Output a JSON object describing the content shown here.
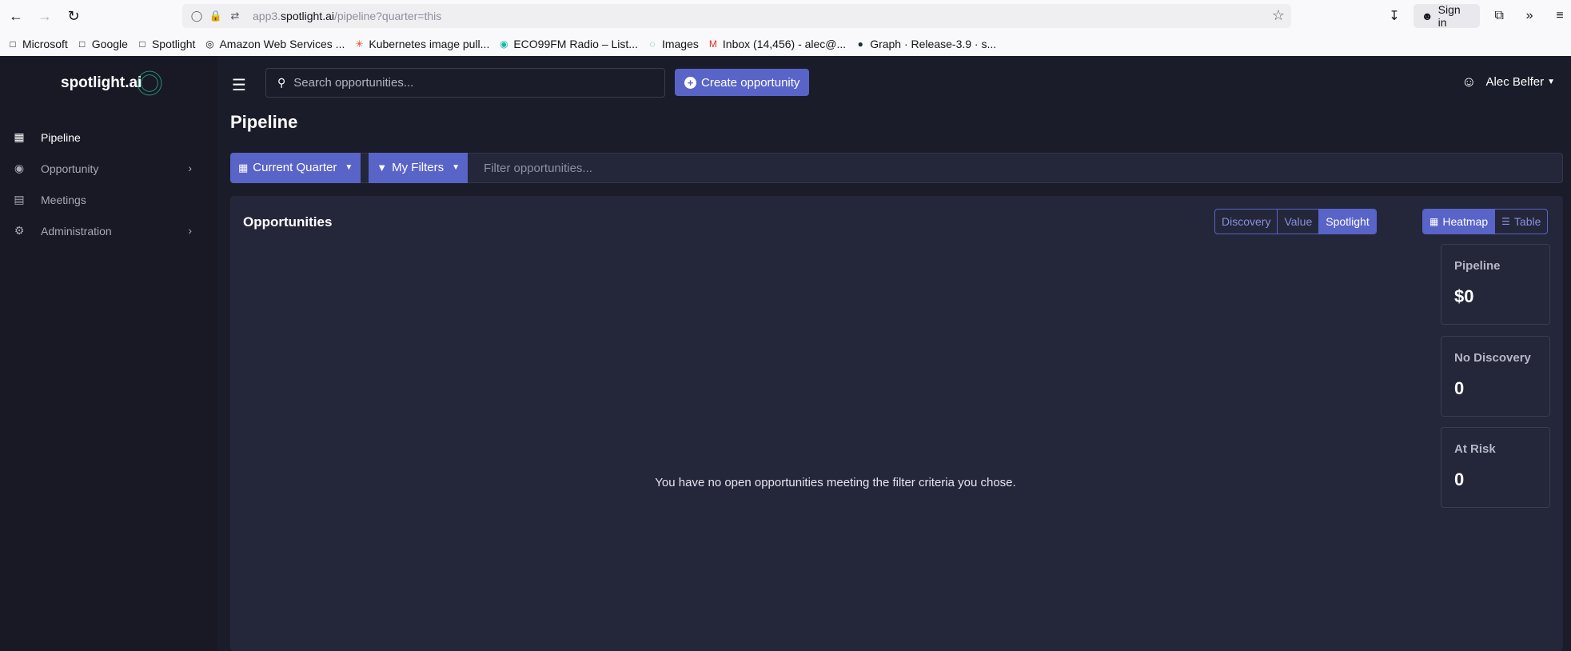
{
  "browser": {
    "url_prefix": "app3.",
    "url_host": "spotlight.ai",
    "url_path": "/pipeline?quarter=this",
    "sign_in_label": "Sign in",
    "bookmarks": [
      {
        "label": "Microsoft",
        "icon": "folder-icon"
      },
      {
        "label": "Google",
        "icon": "folder-icon"
      },
      {
        "label": "Spotlight",
        "icon": "folder-icon"
      },
      {
        "label": "Amazon Web Services ...",
        "icon": "globe-icon"
      },
      {
        "label": "Kubernetes image pull...",
        "icon": "asterisk-icon"
      },
      {
        "label": "ECO99FM Radio – List...",
        "icon": "radio-icon"
      },
      {
        "label": "Images",
        "icon": "spinner-icon"
      },
      {
        "label": "Inbox (14,456) - alec@...",
        "icon": "gmail-icon"
      },
      {
        "label": "Graph · Release-3.9 · s...",
        "icon": "circle-icon"
      }
    ]
  },
  "sidebar": {
    "logo_text": "spotlight.ai",
    "items": [
      {
        "label": "Pipeline",
        "icon": "pipeline-icon"
      },
      {
        "label": "Opportunity",
        "icon": "camera-icon"
      },
      {
        "label": "Meetings",
        "icon": "document-icon"
      },
      {
        "label": "Administration",
        "icon": "settings-icon"
      }
    ]
  },
  "header": {
    "search_placeholder": "Search opportunities...",
    "create_label": "Create opportunity",
    "user_name": "Alec Belfer"
  },
  "page": {
    "title": "Pipeline"
  },
  "filters": {
    "quarter_label": "Current Quarter",
    "my_filters_label": "My Filters",
    "filter_placeholder": "Filter opportunities..."
  },
  "panel": {
    "title": "Opportunities",
    "view_modes": [
      "Discovery",
      "Value",
      "Spotlight"
    ],
    "active_view_mode": "Spotlight",
    "display_modes": [
      "Heatmap",
      "Table"
    ],
    "active_display_mode": "Heatmap",
    "empty_message": "You have no open opportunities meeting the filter criteria you chose.",
    "stats": [
      {
        "label": "Pipeline",
        "value": "$0"
      },
      {
        "label": "No Discovery",
        "value": "0"
      },
      {
        "label": "At Risk",
        "value": "0"
      }
    ]
  },
  "colors": {
    "accent": "#5964c8",
    "sidebar_bg": "#181925",
    "main_bg": "#1b1c29",
    "panel_bg": "#24263a"
  }
}
